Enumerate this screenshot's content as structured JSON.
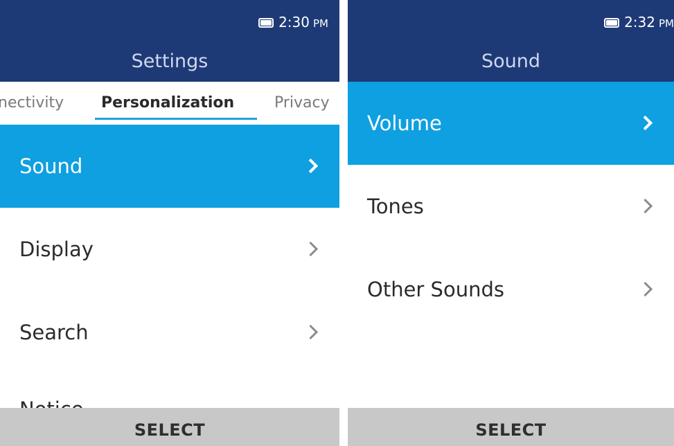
{
  "left_screen": {
    "status": {
      "time": "2:30",
      "ampm": "PM",
      "battery_icon": "battery-icon"
    },
    "header_title": "Settings",
    "tabs": [
      {
        "label": "nectivity"
      },
      {
        "label": "Personalization",
        "active": true
      },
      {
        "label": "Privacy"
      }
    ],
    "menu_items": [
      {
        "label": "Sound",
        "selected": true
      },
      {
        "label": "Display"
      },
      {
        "label": "Search"
      }
    ],
    "partial_item_label": "Notice",
    "softkey_label": "SELECT"
  },
  "right_screen": {
    "status": {
      "time": "2:32",
      "ampm": "PM",
      "battery_icon": "battery-icon"
    },
    "header_title": "Sound",
    "menu_items": [
      {
        "label": "Volume",
        "selected": true
      },
      {
        "label": "Tones"
      },
      {
        "label": "Other Sounds"
      }
    ],
    "softkey_label": "SELECT"
  },
  "colors": {
    "header_bg": "#1e3a76",
    "selected_bg": "#0ea0e0",
    "tab_underline": "#1aa3e0",
    "softkey_bg": "#c8c8c8"
  }
}
